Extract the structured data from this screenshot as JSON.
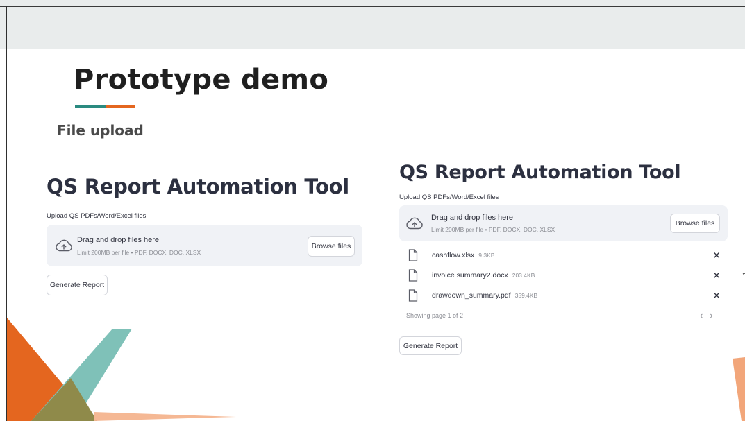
{
  "slide": {
    "title": "Prototype demo",
    "subtitle": "File upload"
  },
  "colors": {
    "teal": "#2a8a80",
    "orange": "#e4661f",
    "topbar": "#e9ecec",
    "dropzone": "#f0f2f6"
  },
  "left_app": {
    "title": "QS Report Automation Tool",
    "upload_label": "Upload QS PDFs/Word/Excel files",
    "dropzone_main": "Drag and drop files here",
    "dropzone_sub": "Limit 200MB per file • PDF, DOCX, DOC, XLSX",
    "browse_label": "Browse files",
    "generate_label": "Generate Report"
  },
  "right_app": {
    "title": "QS Report Automation Tool",
    "upload_label": "Upload QS PDFs/Word/Excel files",
    "dropzone_main": "Drag and drop files here",
    "dropzone_sub": "Limit 200MB per file • PDF, DOCX, DOC, XLSX",
    "browse_label": "Browse files",
    "files": [
      {
        "name": "cashflow.xlsx",
        "size": "9.3KB"
      },
      {
        "name": "invoice summary2.docx",
        "size": "203.4KB"
      },
      {
        "name": "drawdown_summary.pdf",
        "size": "359.4KB"
      }
    ],
    "pager_text": "Showing page 1 of 2",
    "prev_icon": "‹",
    "next_icon": "›",
    "close_icon": "✕",
    "generate_label": "Generate Report"
  },
  "icons": {
    "upload": "cloud-upload-icon",
    "file": "file-icon",
    "close": "close-icon"
  }
}
